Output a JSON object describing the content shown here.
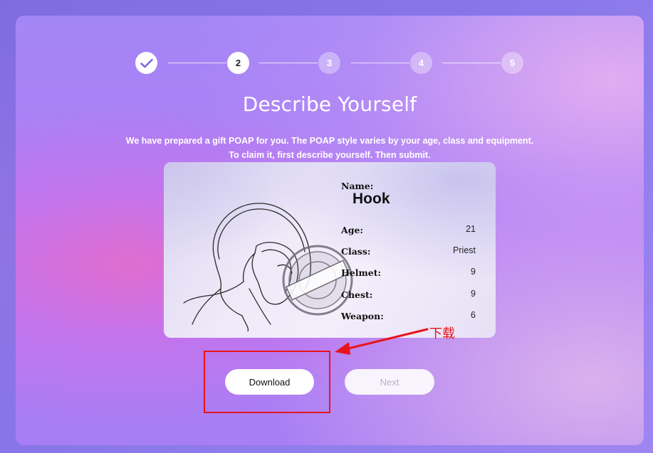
{
  "stepper": {
    "steps": [
      {
        "label": "",
        "state": "done",
        "icon": "check-icon"
      },
      {
        "label": "2",
        "state": "active"
      },
      {
        "label": "3",
        "state": "todo"
      },
      {
        "label": "4",
        "state": "todo"
      },
      {
        "label": "5",
        "state": "todo"
      }
    ]
  },
  "page": {
    "title": "Describe Yourself",
    "description_line1": "We have prepared a gift POAP for you. The POAP style varies by your age, class and equipment.",
    "description_line2": "To claim it, first describe yourself. Then submit."
  },
  "poap_card": {
    "name_label": "Name:",
    "name_value": "Hook",
    "fields": [
      {
        "label": "Age:",
        "value": "21"
      },
      {
        "label": "Class:",
        "value": "Priest"
      },
      {
        "label": "Helmet:",
        "value": "9"
      },
      {
        "label": "Chest:",
        "value": "9"
      },
      {
        "label": "Weapon:",
        "value": "6"
      }
    ],
    "stamp": {
      "center_text": "ATTESTED",
      "ring_text": "Primary Access"
    }
  },
  "buttons": {
    "download_label": "Download",
    "next_label": "Next"
  },
  "annotation": {
    "text": "下载",
    "color": "#e8141c"
  },
  "colors": {
    "accent": "#b27bf5",
    "annotation_red": "#e8141c"
  }
}
